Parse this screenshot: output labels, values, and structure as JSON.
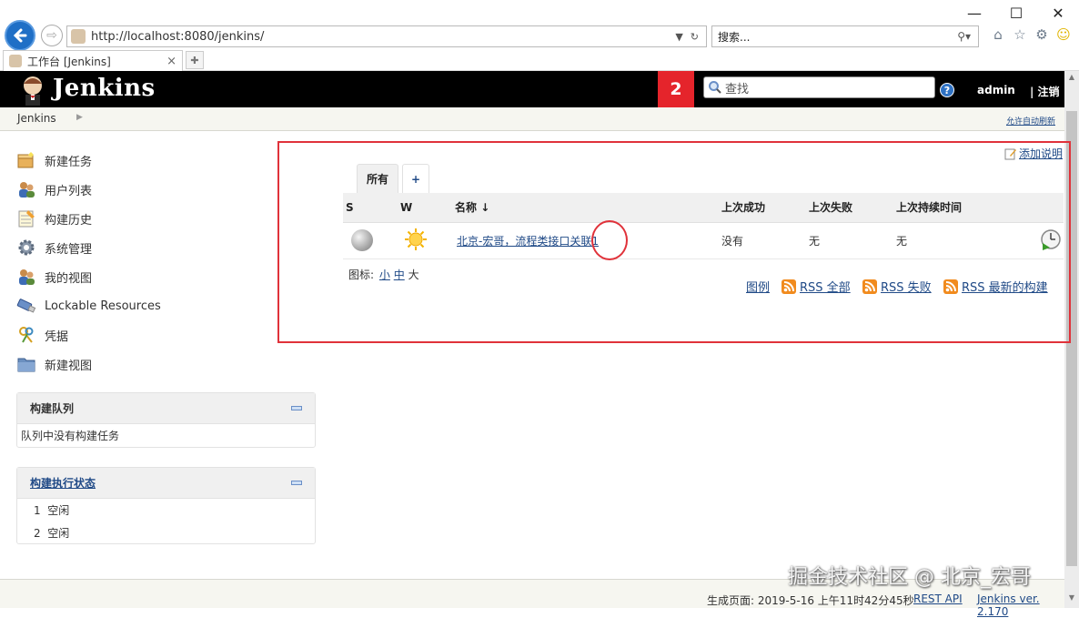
{
  "browser": {
    "url": "http://localhost:8080/jenkins/",
    "search_placeholder": "搜索...",
    "tab_title": "工作台 [Jenkins]"
  },
  "header": {
    "logo_text": "Jenkins",
    "notification_count": "2",
    "search_placeholder": "查找",
    "user": "admin",
    "logout": "| 注销"
  },
  "breadcrumb": {
    "item": "Jenkins",
    "auto_refresh": "允许自动刷新"
  },
  "sidebar": {
    "tasks": [
      {
        "label": "新建任务",
        "icon": "new-item-icon"
      },
      {
        "label": "用户列表",
        "icon": "people-icon"
      },
      {
        "label": "构建历史",
        "icon": "notepad-icon"
      },
      {
        "label": "系统管理",
        "icon": "gear-icon"
      },
      {
        "label": "我的视图",
        "icon": "user-view-icon"
      },
      {
        "label": "Lockable Resources",
        "icon": "usb-icon"
      },
      {
        "label": "凭据",
        "icon": "keys-icon"
      },
      {
        "label": "新建视图",
        "icon": "folder-icon"
      }
    ],
    "build_queue": {
      "title": "构建队列",
      "empty": "队列中没有构建任务"
    },
    "executors": {
      "title": "构建执行状态",
      "rows": [
        {
          "num": "1",
          "status": "空闲"
        },
        {
          "num": "2",
          "status": "空闲"
        }
      ]
    }
  },
  "main": {
    "add_description": "添加说明",
    "tabs": [
      {
        "label": "所有"
      },
      {
        "label": "+"
      }
    ],
    "columns": {
      "s": "S",
      "w": "W",
      "name": "名称",
      "sort": "↓",
      "last_success": "上次成功",
      "last_failure": "上次失败",
      "last_duration": "上次持续时间"
    },
    "jobs": [
      {
        "name": "北京-宏哥，流程类接口关联1",
        "last_success": "没有",
        "last_failure": "无",
        "last_duration": "无",
        "status": "notbuilt",
        "weather": "sunny"
      }
    ],
    "icon_size": {
      "label": "图标:",
      "small": "小",
      "medium": "中",
      "large": "大"
    },
    "links": {
      "legend": "图例",
      "rss_all": "RSS 全部",
      "rss_failed": "RSS 失败",
      "rss_latest": "RSS 最新的构建"
    }
  },
  "footer": {
    "generated": "生成页面: 2019-5-16 上午11时42分45秒",
    "rest_api": "REST API",
    "version": "Jenkins ver. 2.170"
  },
  "watermark": "掘金技术社区 @ 北京_宏哥",
  "colors": {
    "accent_red": "#e5242b",
    "link": "#204a87",
    "header_bg": "#000000"
  }
}
